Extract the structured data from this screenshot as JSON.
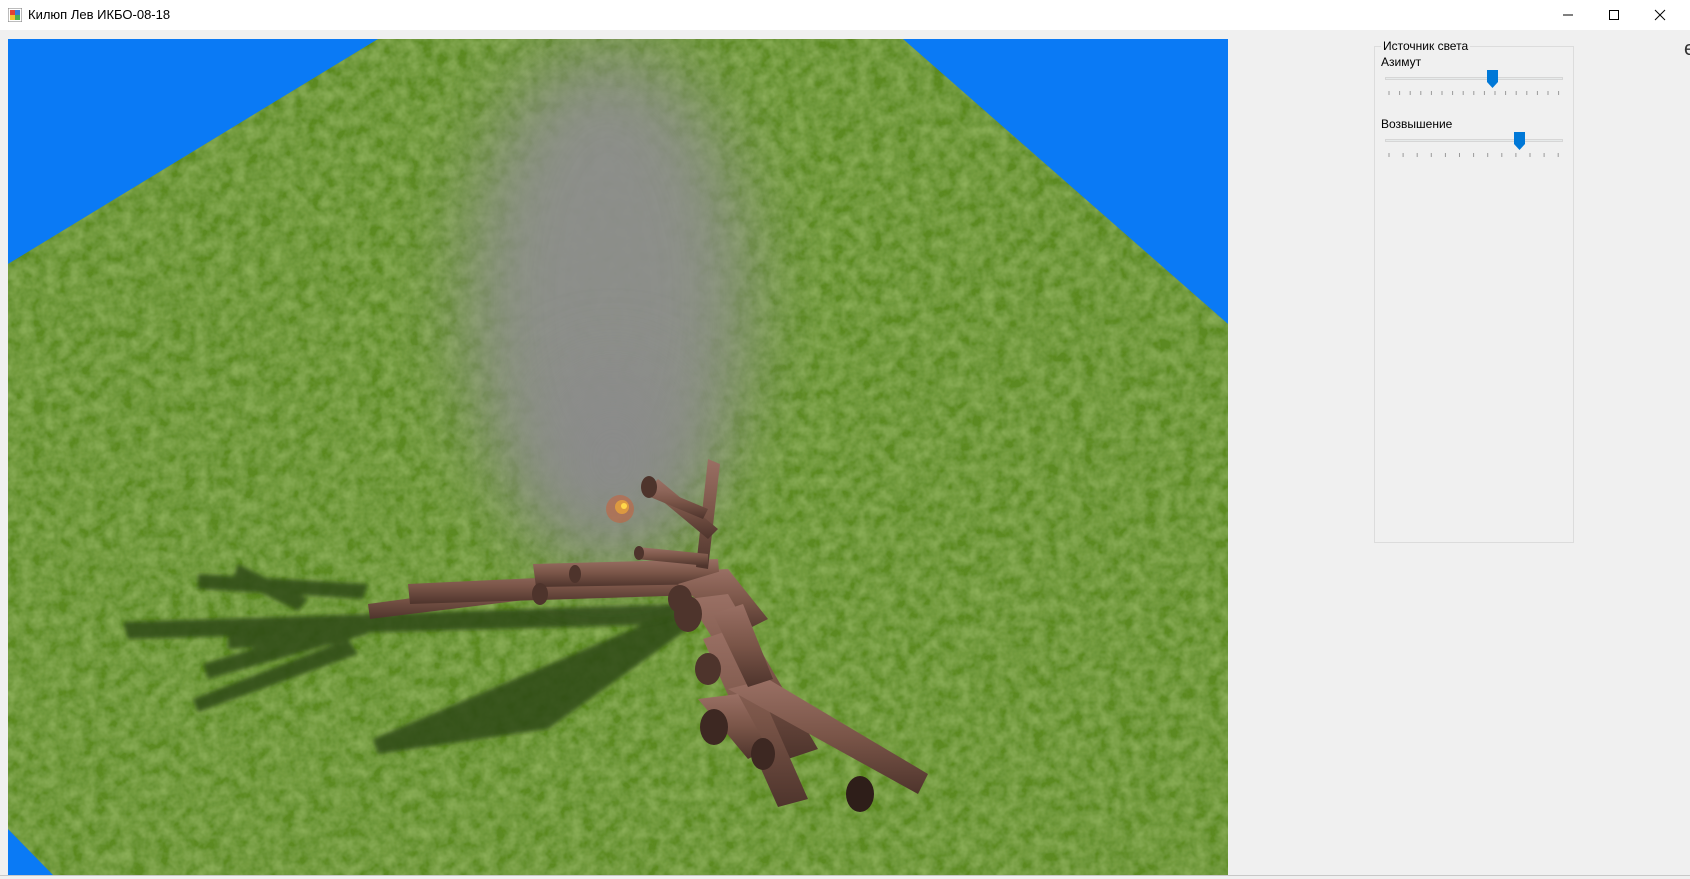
{
  "window": {
    "title": "Килюп Лев ИКБО-08-18",
    "icon": "app-window-icon",
    "controls": [
      "minimize-icon",
      "maximize-icon",
      "close-icon"
    ]
  },
  "scene": {
    "description_icons": [
      "grass-plane",
      "log-bonfire",
      "smoke-column",
      "fire-sparks",
      "log-shadows"
    ],
    "colors": {
      "sky": "#0a7af5",
      "grass": "#5f8a25",
      "wood": "#7a5548",
      "smoke": "#8a8a8a",
      "shadow": "#2f4a12"
    }
  },
  "light_panel": {
    "title": "Источник света",
    "azimuth": {
      "label": "Азимут",
      "value": 0.61
    },
    "elevation": {
      "label": "Возвышение",
      "value": 0.77
    }
  },
  "edge_fragment": "e"
}
